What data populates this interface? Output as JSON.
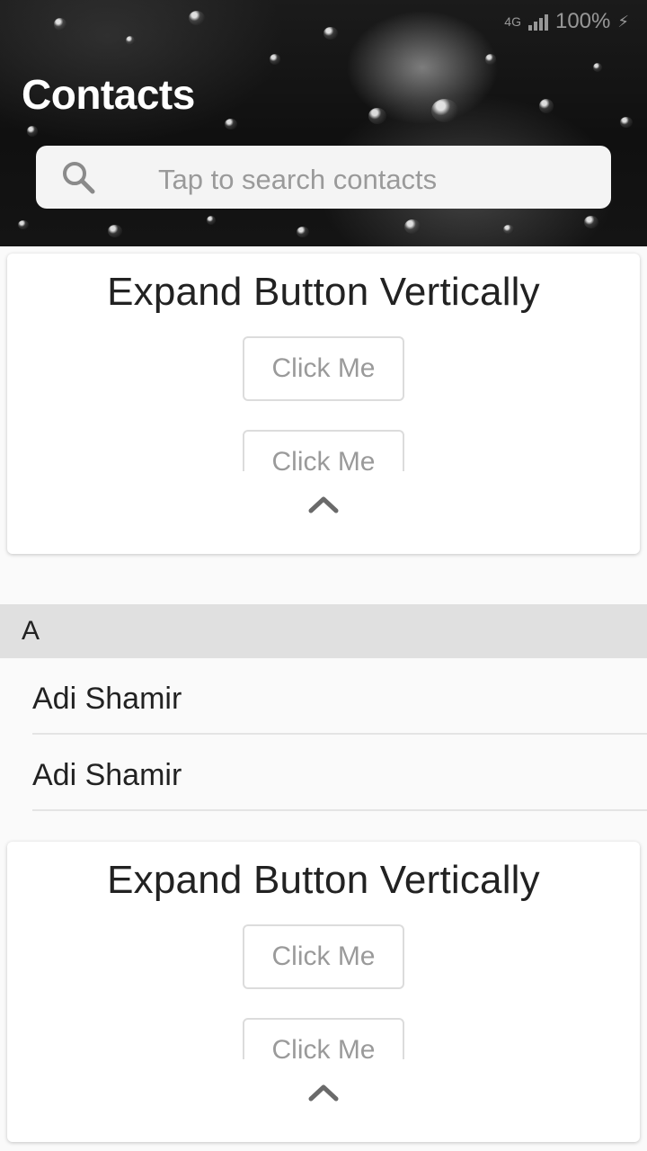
{
  "status_bar": {
    "network": "4G",
    "battery": "100%"
  },
  "header": {
    "title": "Contacts"
  },
  "search": {
    "placeholder": "Tap to search contacts",
    "icon": "search-icon"
  },
  "cards": [
    {
      "title": "Expand Button Vertically",
      "buttons": [
        "Click Me",
        "Click Me"
      ],
      "toggle_icon": "chevron-up-icon"
    },
    {
      "title": "Expand Button Vertically",
      "buttons": [
        "Click Me",
        "Click Me"
      ],
      "toggle_icon": "chevron-up-icon"
    }
  ],
  "sections": [
    {
      "letter": "A",
      "contacts": [
        "Adi Shamir",
        "Adi Shamir"
      ]
    }
  ],
  "colors": {
    "card_bg": "#ffffff",
    "section_header_bg": "#e0e0e0",
    "page_bg": "#fafafa",
    "search_bg": "#f4f4f4",
    "button_text": "#9a9a9a"
  }
}
